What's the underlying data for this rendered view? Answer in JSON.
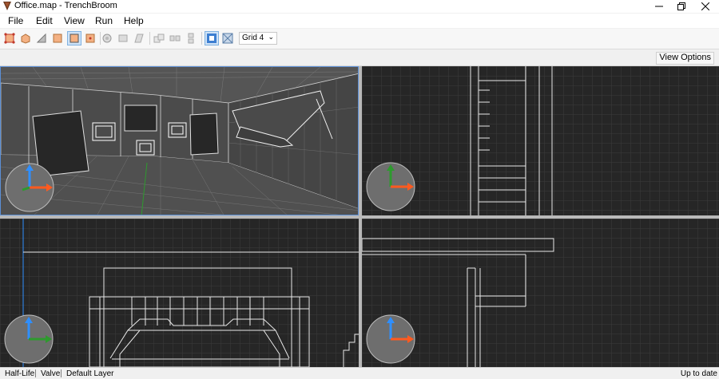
{
  "window": {
    "title": "Office.map - TrenchBroom"
  },
  "menu": {
    "items": [
      "File",
      "Edit",
      "View",
      "Run",
      "Help"
    ]
  },
  "toolbar": {
    "tools": [
      "brush-tool",
      "clip-tool",
      "vertex-tool",
      "edge-tool",
      "face-tool",
      "entity-tool",
      "rotate-tool",
      "scale-tool",
      "shear-tool",
      "flip-horizontal",
      "flip-vertical",
      "duplicate",
      "texture-lock",
      "uv-lock"
    ],
    "grid_label": "Grid 4"
  },
  "view_options_label": "View Options",
  "colors": {
    "viewport_bg": "#262626",
    "grid_line": "#3a3a3a",
    "wire": "#e8e8e8",
    "axis_x": "#ff5a1f",
    "axis_y": "#2e9a2e",
    "axis_z": "#2f8fff",
    "selection": "#5b8fd6"
  },
  "status": {
    "game": "Half-Life",
    "format": "Valve",
    "layer": "Default Layer",
    "update": "Up to date"
  }
}
